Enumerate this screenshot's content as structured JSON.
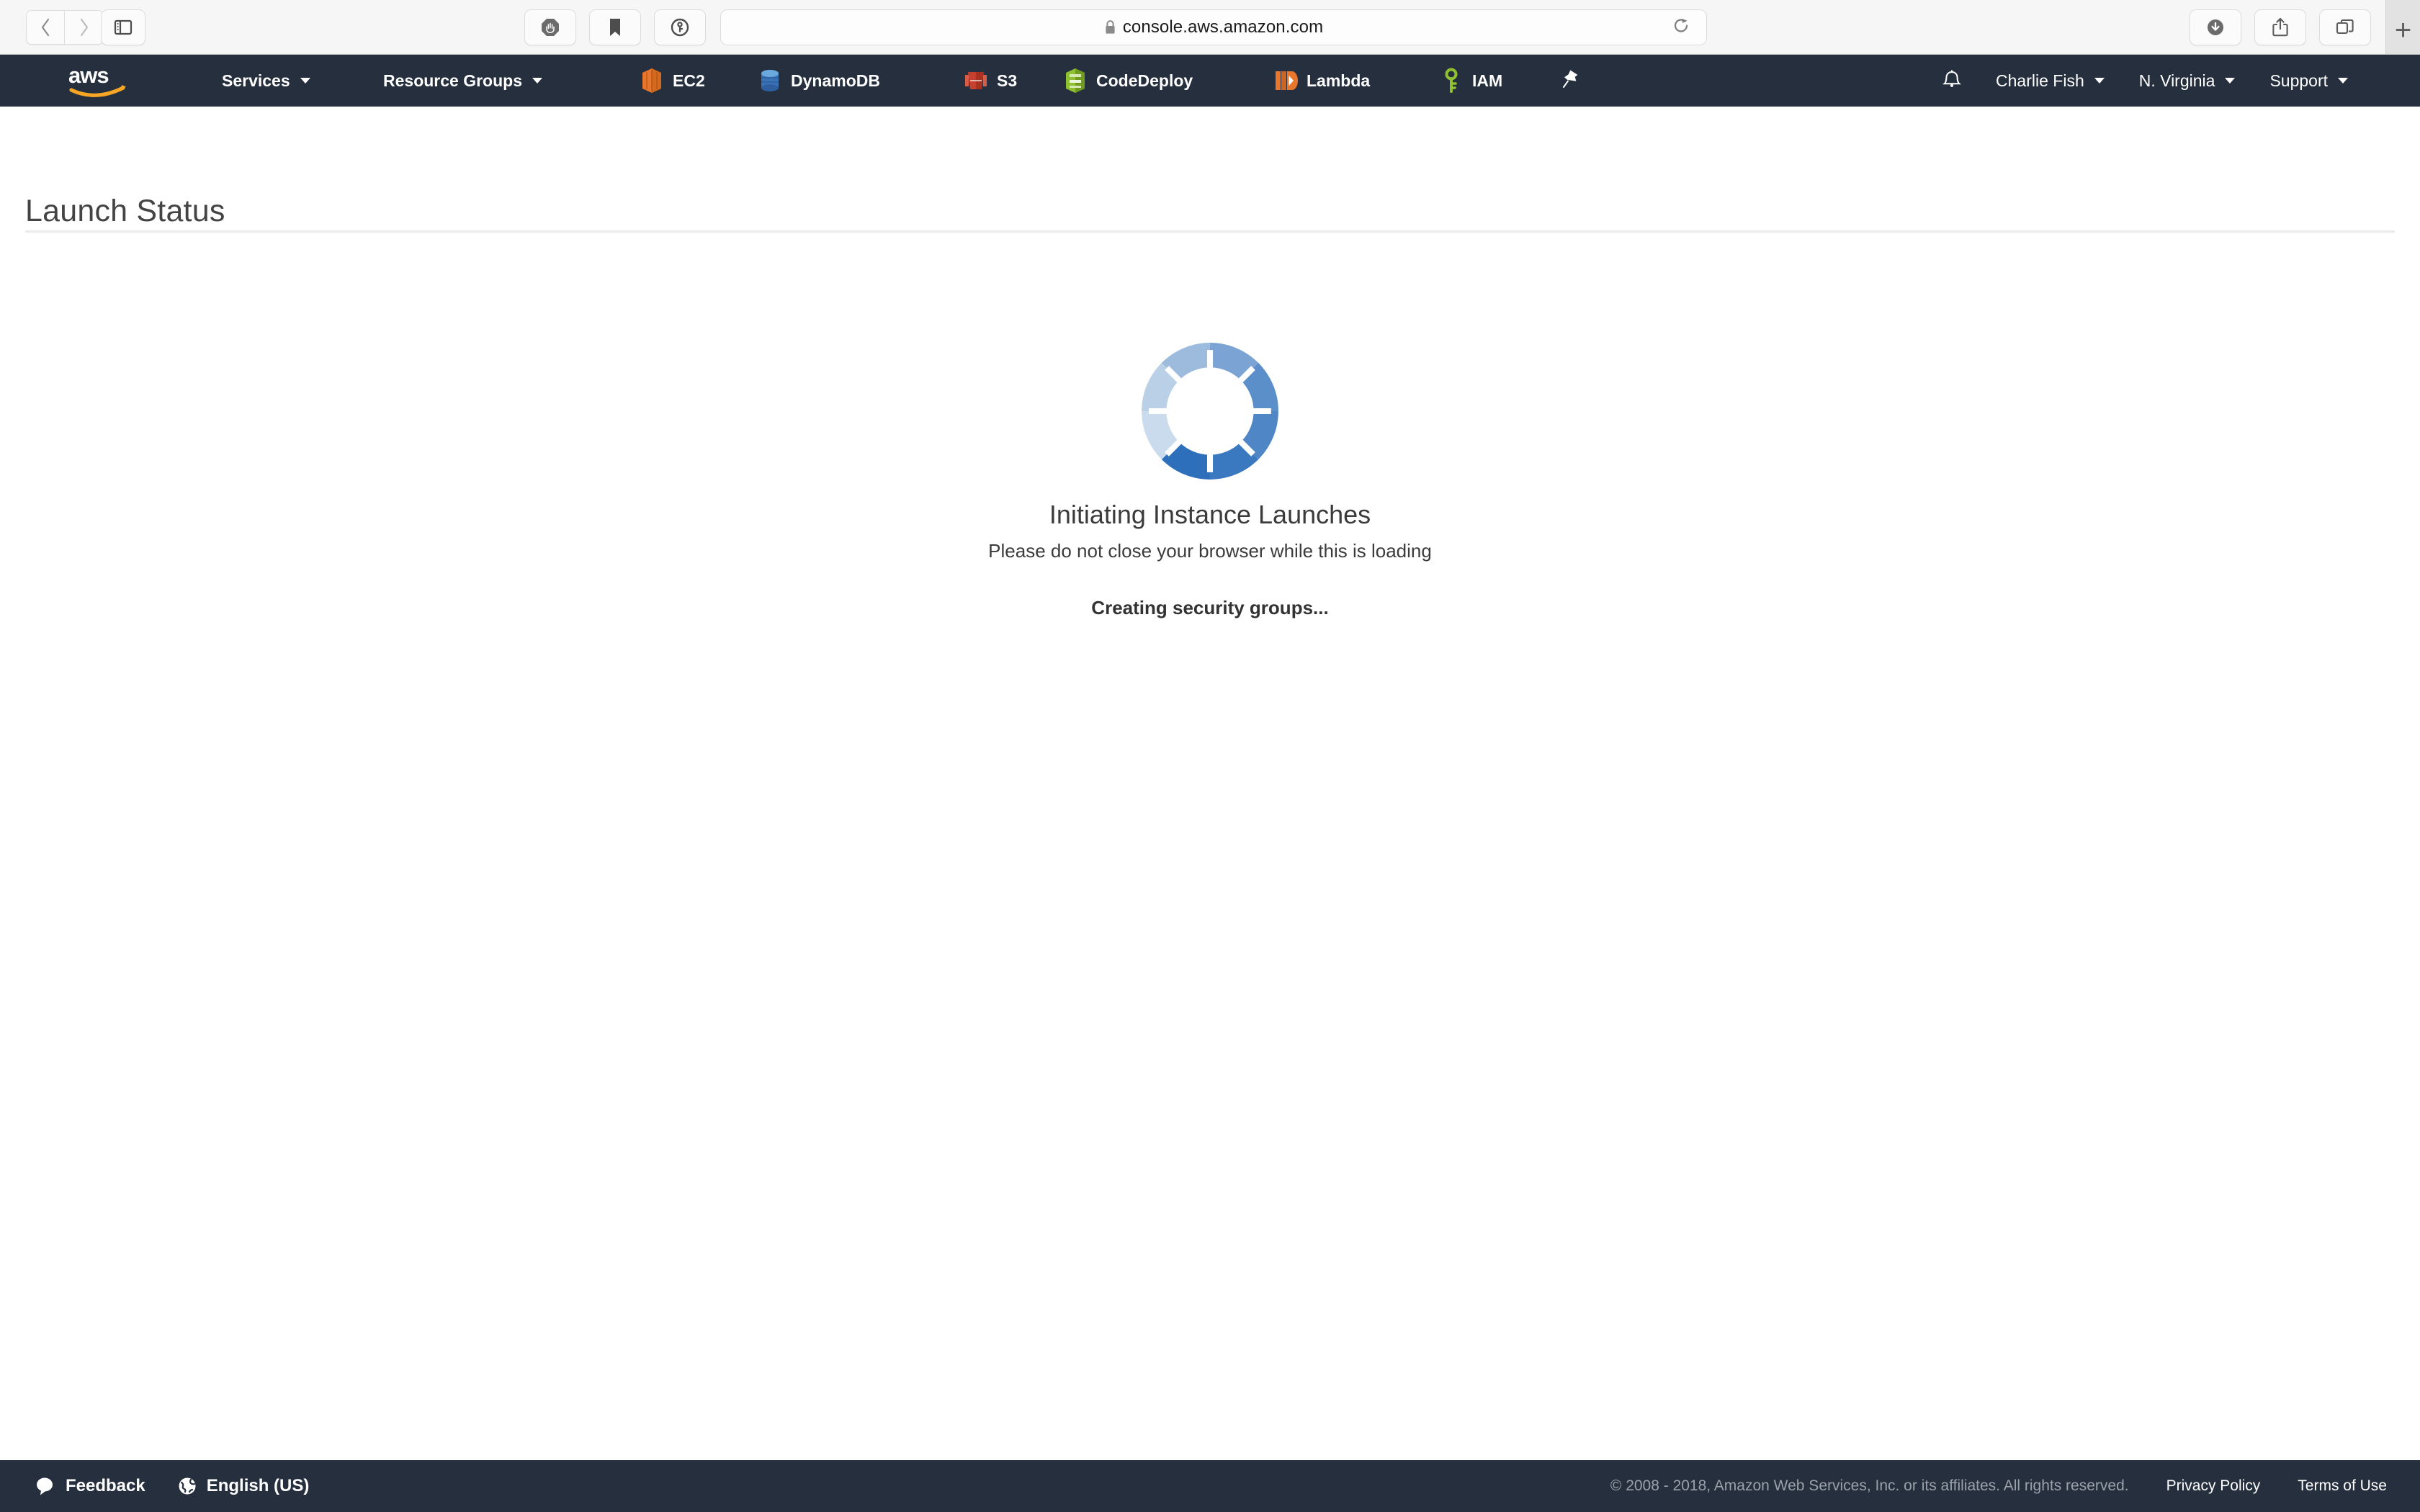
{
  "browser": {
    "back_label": "Back",
    "forward_label": "Forward",
    "sidebar_label": "Show Sidebar",
    "extensions": [
      {
        "name": "adblock-icon",
        "label": "AdBlock"
      },
      {
        "name": "bookmark-icon",
        "label": "Bookmark"
      },
      {
        "name": "password-manager-icon",
        "label": "1Password"
      }
    ],
    "url": "console.aws.amazon.com",
    "lock_label": "Secure",
    "reload_label": "Reload",
    "downloads_label": "Downloads",
    "share_label": "Share",
    "tabs_label": "Show Tab Overview",
    "new_tab_label": "+"
  },
  "navbar": {
    "logo_alt": "aws",
    "services_label": "Services",
    "resource_groups_label": "Resource Groups",
    "shortcuts": [
      {
        "label": "EC2",
        "icon": "ec2-icon",
        "color": "#e8762d"
      },
      {
        "label": "DynamoDB",
        "icon": "dynamodb-icon",
        "color": "#3b73b9"
      },
      {
        "label": "S3",
        "icon": "s3-icon",
        "color": "#c4402f"
      },
      {
        "label": "CodeDeploy",
        "icon": "codedeploy-icon",
        "color": "#7aa116"
      },
      {
        "label": "Lambda",
        "icon": "lambda-icon",
        "color": "#e8762d"
      },
      {
        "label": "IAM",
        "icon": "iam-icon",
        "color": "#7aa116"
      }
    ],
    "pin_label": "Pin",
    "notifications_label": "Notifications",
    "account_label": "Charlie Fish",
    "region_label": "N. Virginia",
    "support_label": "Support"
  },
  "page": {
    "title": "Launch Status"
  },
  "status": {
    "spinner_label": "loading-spinner",
    "heading": "Initiating Instance Launches",
    "subtext": "Please do not close your browser while this is loading",
    "step": "Creating security groups...",
    "spinner_colors": [
      "#9cbbdd",
      "#7ba3d3",
      "#6a99cf",
      "#4e86c6",
      "#3a78c0",
      "#2e6fbb",
      "#b9d0e6",
      "#c9dbec"
    ]
  },
  "footer": {
    "feedback_label": "Feedback",
    "language_label": "English (US)",
    "copyright": "© 2008 - 2018, Amazon Web Services, Inc. or its affiliates. All rights reserved.",
    "privacy_label": "Privacy Policy",
    "terms_label": "Terms of Use"
  },
  "colors": {
    "navbar_bg": "#252f3e",
    "aws_orange": "#f6a623"
  }
}
